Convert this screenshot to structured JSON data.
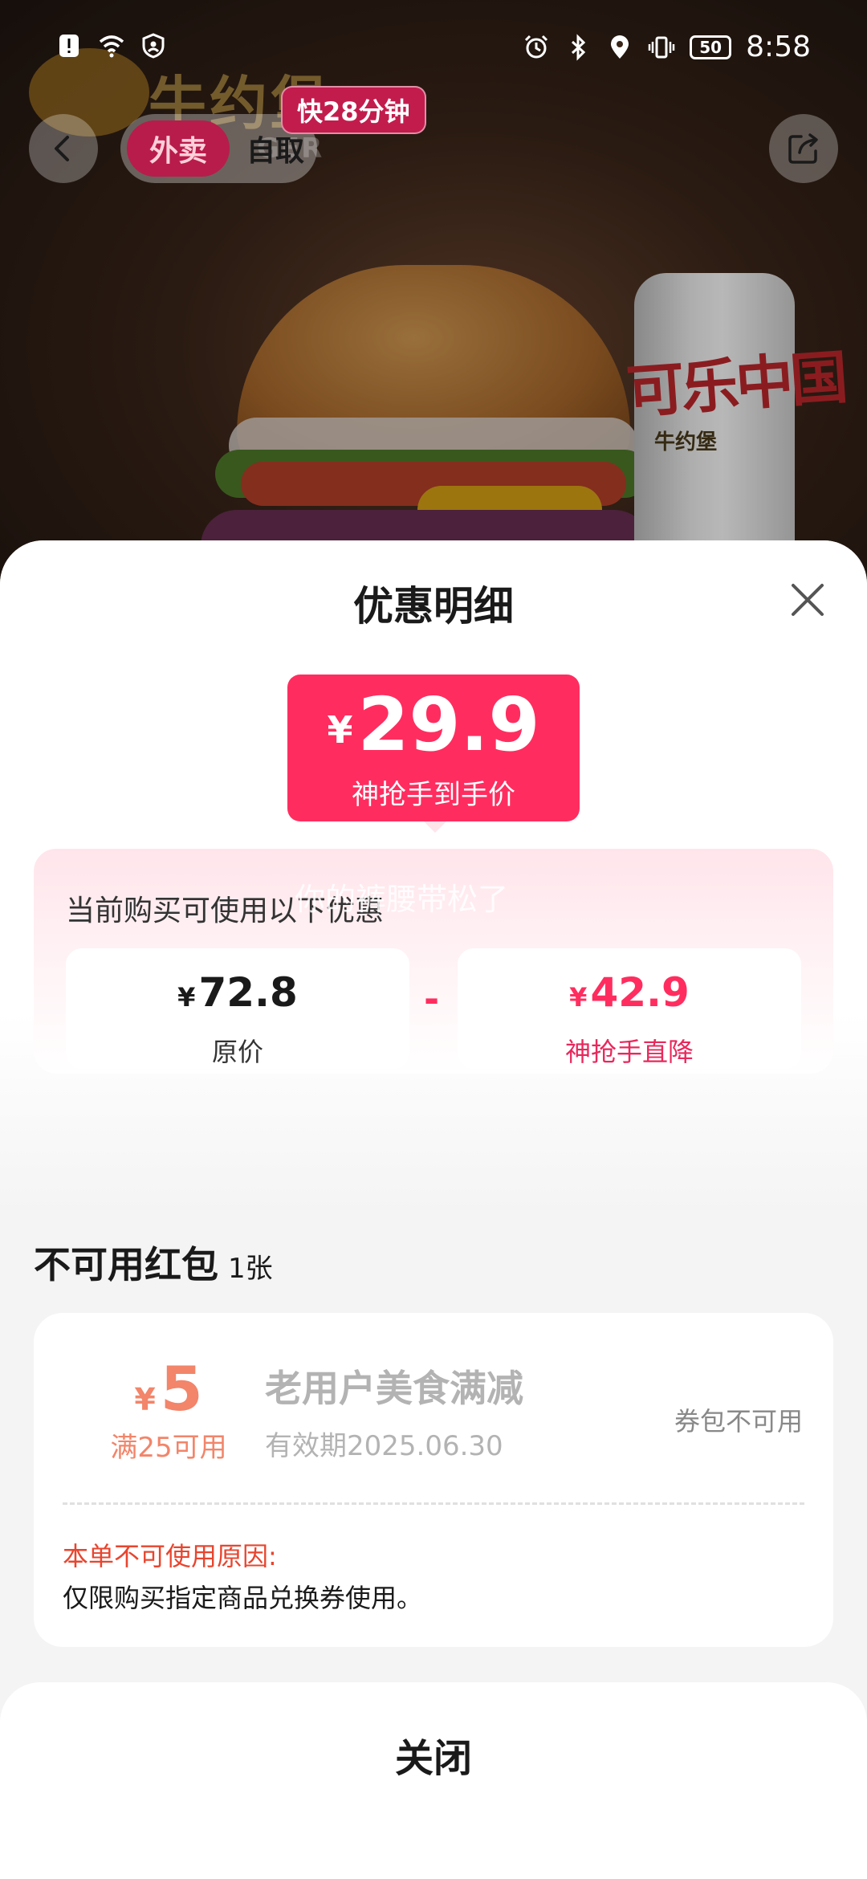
{
  "status_bar": {
    "time": "8:58",
    "battery": "50",
    "icons": [
      "alert-icon",
      "wifi-icon",
      "vpn-shield-icon",
      "alarm-icon",
      "bluetooth-icon",
      "location-icon",
      "vibrate-icon",
      "battery-icon"
    ]
  },
  "header": {
    "brand_name": "牛约堡",
    "brand_sub": "GER",
    "mode_active": "外卖",
    "mode_inactive": "自取",
    "eta": "快28分钟"
  },
  "hero": {
    "can_text": "可乐中国",
    "can_brand": "牛约堡"
  },
  "sheet": {
    "title": "优惠明细",
    "price": {
      "currency": "¥",
      "amount": "29.9",
      "label": "神抢手到手价"
    },
    "discount": {
      "hint": "当前购买可使用以下优惠",
      "watermark": "你的裤腰带松了",
      "original": {
        "currency": "¥",
        "amount": "72.8",
        "label": "原价"
      },
      "operator": "-",
      "reduction": {
        "currency": "¥",
        "amount": "42.9",
        "label": "神抢手直降"
      }
    },
    "unusable": {
      "title": "不可用红包",
      "count": "1张",
      "coupon": {
        "currency": "¥",
        "amount": "5",
        "condition": "满25可用",
        "name": "老用户美食满减",
        "expiry": "有效期2025.06.30",
        "status": "券包不可用",
        "reason_title": "本单不可使用原因:",
        "reason": "仅限购买指定商品兑换券使用。"
      }
    },
    "close_label": "关闭"
  },
  "colors": {
    "accent": "#ff2d5f",
    "coupon_orange": "#f2856a",
    "reason_red": "#e8452e",
    "mode_active_bg": "#b81c4a"
  }
}
